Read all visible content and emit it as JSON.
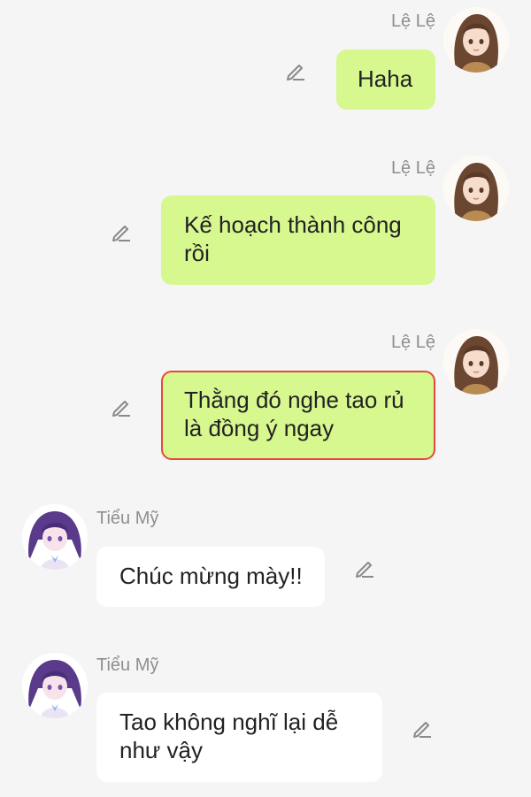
{
  "messages": [
    {
      "sender": "Lệ Lệ",
      "side": "right",
      "text": "Haha",
      "selected": false,
      "edit_icon": "pencil-icon",
      "avatar": "avatar-le-le"
    },
    {
      "sender": "Lệ Lệ",
      "side": "right",
      "text": "Kế hoạch thành công rồi",
      "selected": false,
      "edit_icon": "pencil-icon",
      "avatar": "avatar-le-le"
    },
    {
      "sender": "Lệ Lệ",
      "side": "right",
      "text": "Thằng đó nghe tao rủ là đồng ý ngay",
      "selected": true,
      "edit_icon": "pencil-icon",
      "avatar": "avatar-le-le"
    },
    {
      "sender": "Tiểu Mỹ",
      "side": "left",
      "text": "Chúc mừng mày!!",
      "selected": false,
      "edit_icon": "pencil-icon",
      "avatar": "avatar-tieu-my"
    },
    {
      "sender": "Tiểu Mỹ",
      "side": "left",
      "text": "Tao không nghĩ lại dễ như vậy",
      "selected": false,
      "edit_icon": "pencil-icon",
      "avatar": "avatar-tieu-my"
    }
  ],
  "colors": {
    "background": "#f5f5f5",
    "my_bubble": "#d7f78f",
    "other_bubble": "#ffffff",
    "selected_border": "#e5483f",
    "sender_name": "#8e8e8e"
  }
}
